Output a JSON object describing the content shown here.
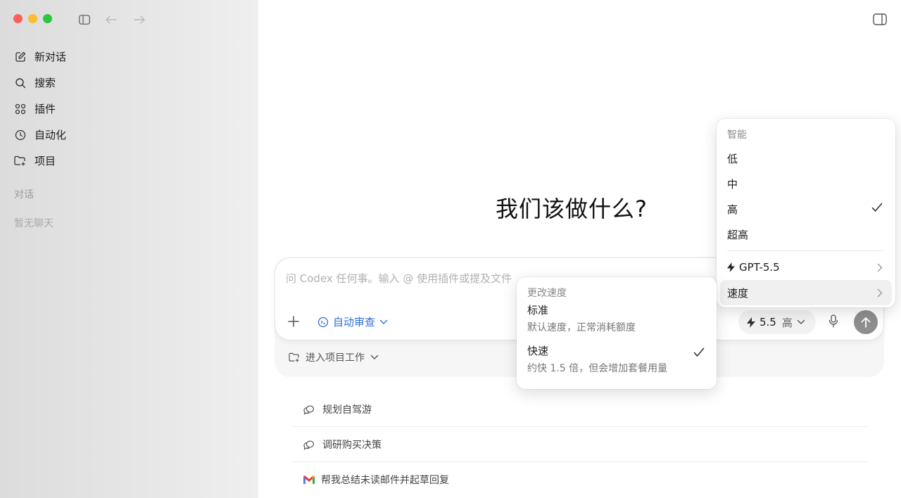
{
  "sidebar": {
    "nav": [
      {
        "label": "新对话",
        "icon": "edit-icon"
      },
      {
        "label": "搜索",
        "icon": "search-icon"
      },
      {
        "label": "插件",
        "icon": "grid-icon"
      },
      {
        "label": "自动化",
        "icon": "clock-icon"
      },
      {
        "label": "项目",
        "icon": "folder-add-icon"
      }
    ],
    "section_label": "对话",
    "empty_label": "暂无聊天"
  },
  "main": {
    "headline": "我们该做什么?",
    "composer": {
      "placeholder": "问 Codex 任何事。输入 @ 使用插件或提及文件",
      "auto_review_label": "自动审查",
      "model_version": "5.5",
      "model_level": "高"
    },
    "project_label": "进入项目工作",
    "suggestions": [
      {
        "label": "规划自驾游",
        "icon": "chat-bubbles-icon"
      },
      {
        "label": "调研购买决策",
        "icon": "chat-bubbles-icon"
      },
      {
        "label": "帮我总结未读邮件并起草回复",
        "icon": "gmail-icon"
      }
    ]
  },
  "intelligence_menu": {
    "header": "智能",
    "levels": [
      {
        "label": "低",
        "checked": false
      },
      {
        "label": "中",
        "checked": false
      },
      {
        "label": "高",
        "checked": true
      },
      {
        "label": "超高",
        "checked": false
      }
    ],
    "model_item": "GPT-5.5",
    "speed_item": "速度"
  },
  "speed_menu": {
    "header": "更改速度",
    "options": [
      {
        "title": "标准",
        "desc": "默认速度，正常消耗额度",
        "checked": false
      },
      {
        "title": "快速",
        "desc": "约快 1.5 倍，但会增加套餐用量",
        "checked": true
      }
    ]
  },
  "colors": {
    "accent": "#2f6ed9",
    "send_button": "#8e8e8e",
    "traffic_red": "#ff5f57",
    "traffic_yellow": "#febc2e",
    "traffic_green": "#28c840"
  }
}
